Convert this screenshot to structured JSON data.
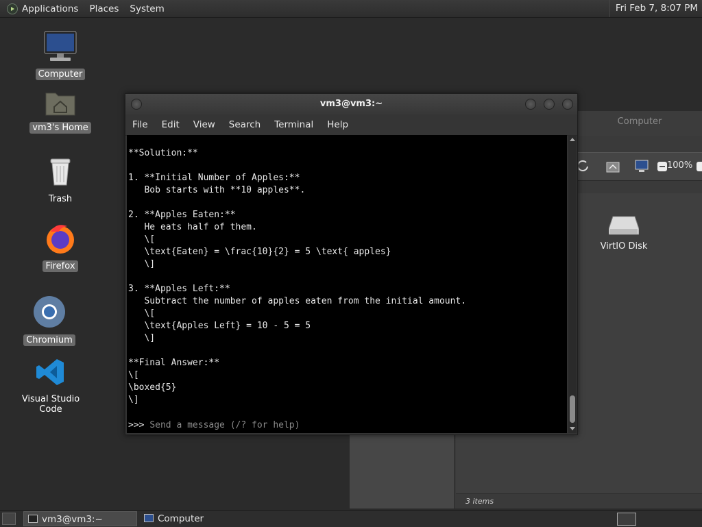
{
  "top_panel": {
    "menus": [
      "Applications",
      "Places",
      "System"
    ],
    "clock": "Fri Feb  7,  8:07 PM"
  },
  "desktop_icons": [
    {
      "label": "Computer",
      "icon": "computer-icon",
      "selected": true
    },
    {
      "label": "vm3's Home",
      "icon": "home-folder-icon",
      "selected": true
    },
    {
      "label": "Trash",
      "icon": "trash-icon",
      "selected": false
    },
    {
      "label": "Firefox",
      "icon": "firefox-icon",
      "selected": true
    },
    {
      "label": "Chromium",
      "icon": "chromium-icon",
      "selected": true
    },
    {
      "label": "Visual Studio Code",
      "icon": "vscode-icon",
      "selected": false
    }
  ],
  "file_manager": {
    "title": "Computer",
    "zoom": "100%",
    "items": [
      {
        "label": "VirtIO Disk",
        "icon": "disk-icon"
      }
    ],
    "status": "3 items"
  },
  "terminal": {
    "title": "vm3@vm3:~",
    "menus": [
      "File",
      "Edit",
      "View",
      "Search",
      "Terminal",
      "Help"
    ],
    "lines": [
      "**Solution:**",
      "",
      "1. **Initial Number of Apples:**",
      "   Bob starts with **10 apples**.",
      "",
      "2. **Apples Eaten:**",
      "   He eats half of them.",
      "   \\[",
      "   \\text{Eaten} = \\frac{10}{2} = 5 \\text{ apples}",
      "   \\]",
      "",
      "3. **Apples Left:**",
      "   Subtract the number of apples eaten from the initial amount.",
      "   \\[",
      "   \\text{Apples Left} = 10 - 5 = 5",
      "   \\]",
      "",
      "**Final Answer:**",
      "\\[",
      "\\boxed{5}",
      "\\]"
    ],
    "prompt": ">>> ",
    "input_placeholder": "Send a message (/? for help)"
  },
  "taskbar": {
    "windows": [
      {
        "label": "vm3@vm3:~",
        "icon": "terminal-icon",
        "active": true
      },
      {
        "label": "Computer",
        "icon": "computer-icon",
        "active": false
      }
    ]
  }
}
